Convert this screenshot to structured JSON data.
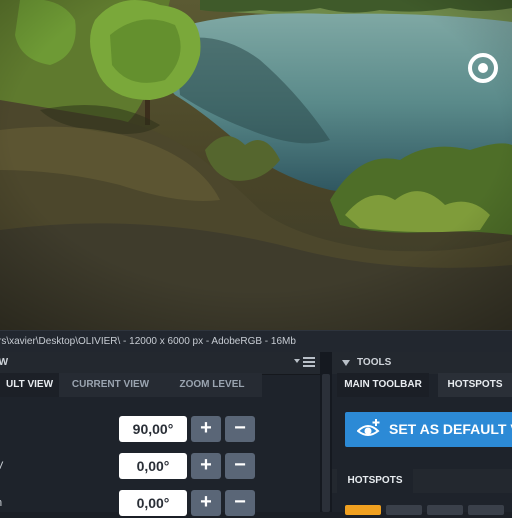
{
  "statusbar": {
    "text": "rs\\xavier\\Desktop\\OLIVIER\\  -  12000 x 6000 px  -  AdobeRGB  -  16Mb"
  },
  "left_panel": {
    "title": "EW",
    "tabs": [
      {
        "label": "ULT VIEW",
        "active": true
      },
      {
        "label": "CURRENT VIEW",
        "active": false
      },
      {
        "label": "ZOOM LEVEL",
        "active": false
      }
    ],
    "rows": [
      {
        "label": "/",
        "value": "90,00°",
        "plus": "+",
        "minus": "−"
      },
      {
        "label": "V",
        "value": "0,00°",
        "plus": "+",
        "minus": "−"
      },
      {
        "label": "h",
        "value": "0,00°",
        "plus": "+",
        "minus": "−"
      }
    ]
  },
  "right_panel": {
    "title": "TOOLS",
    "tabs": [
      {
        "label": "MAIN TOOLBAR",
        "active": true
      },
      {
        "label": "HOTSPOTS",
        "active": false
      }
    ],
    "set_default_label": "SET AS DEFAULT VI",
    "section_title": "HOTSPOTS"
  },
  "colors": {
    "accent": "#2c8ad6",
    "swatch_orange": "#f0a020"
  },
  "icons": [
    "target-icon",
    "hamburger-menu-icon",
    "eye-plus-icon",
    "collapse-triangle-icon"
  ]
}
